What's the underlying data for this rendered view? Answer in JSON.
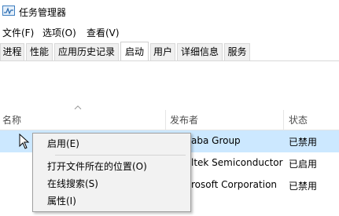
{
  "window": {
    "title": "任务管理器",
    "icon": "task-manager-icon"
  },
  "menubar": {
    "items": [
      "文件(F)",
      "选项(O)",
      "查看(V)"
    ]
  },
  "tabs": [
    "进程",
    "性能",
    "应用历史记录",
    "启动",
    "用户",
    "详细信息",
    "服务"
  ],
  "active_tab": "启动",
  "table": {
    "columns": [
      "名称",
      "发布者",
      "状态"
    ],
    "sorted_column": "名称",
    "rows": [
      {
        "name": "",
        "publisher": "aba Group",
        "status": "已禁用"
      },
      {
        "name": "",
        "publisher": "ltek Semiconductor",
        "status": "已启用"
      },
      {
        "name": "",
        "publisher": "rosoft Corporation",
        "status": "已禁用"
      }
    ]
  },
  "context_menu": {
    "items": [
      "启用(E)",
      "打开文件所在的位置(O)",
      "在线搜索(S)",
      "属性(I)"
    ]
  },
  "colors": {
    "selection": "#cce8ff",
    "menu_bg": "#f2f2f2"
  }
}
